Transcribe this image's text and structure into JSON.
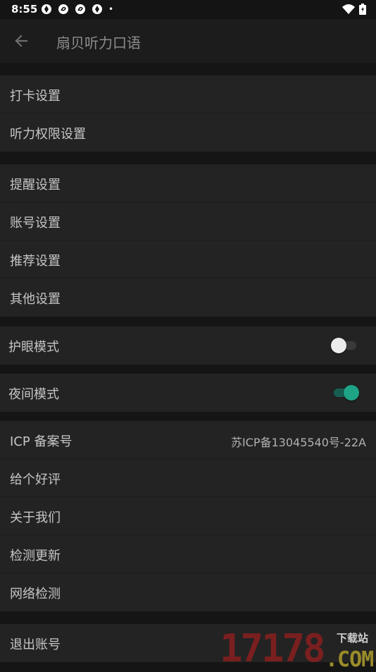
{
  "status_bar": {
    "time": "8:55",
    "notification_icons": [
      "aperture-icon",
      "swirl-icon",
      "swirl-icon",
      "aperture-icon"
    ],
    "dot": "•"
  },
  "app_bar": {
    "title": "扇贝听力口语"
  },
  "groups": [
    {
      "items": [
        {
          "label": "打卡设置"
        },
        {
          "label": "听力权限设置"
        }
      ]
    },
    {
      "items": [
        {
          "label": "提醒设置"
        },
        {
          "label": "账号设置"
        },
        {
          "label": "推荐设置"
        },
        {
          "label": "其他设置"
        }
      ]
    },
    {
      "items": [
        {
          "label": "护眼模式",
          "toggle": false
        }
      ]
    },
    {
      "items": [
        {
          "label": "夜间模式",
          "toggle": true
        }
      ]
    },
    {
      "items": [
        {
          "label": "ICP 备案号",
          "value": "苏ICP备13045540号-22A"
        },
        {
          "label": "给个好评"
        },
        {
          "label": "关于我们"
        },
        {
          "label": "检测更新"
        },
        {
          "label": "网络检测"
        }
      ]
    },
    {
      "items": [
        {
          "label": "退出账号"
        }
      ]
    }
  ],
  "watermark": {
    "digits": "17178",
    "small": "下载站",
    "com": ".COM"
  },
  "colors": {
    "background": "#151515",
    "row": "#232323",
    "switch_on": "#1ea387"
  }
}
